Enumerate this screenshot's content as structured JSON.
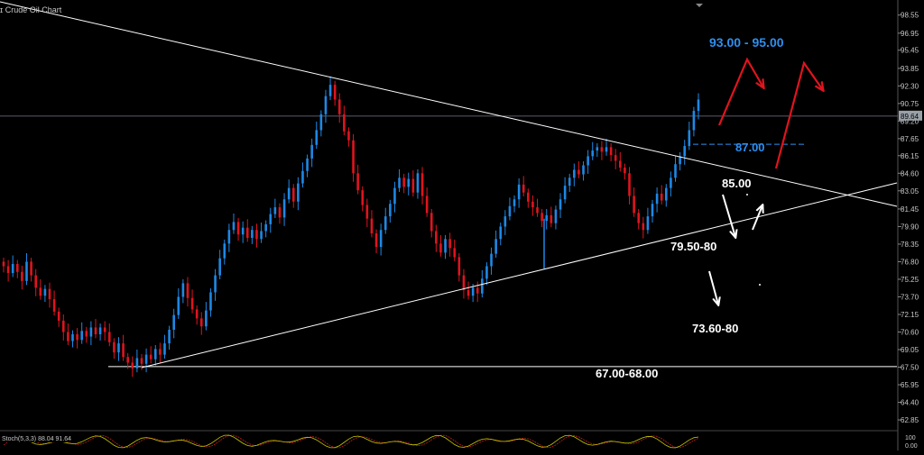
{
  "chart_data": {
    "type": "candlestick",
    "title": "ɪ Crude Oil Chart",
    "y_axis": {
      "ticks": [
        "98.55",
        "96.95",
        "95.45",
        "93.85",
        "92.30",
        "90.75",
        "89.20",
        "87.65",
        "86.15",
        "84.60",
        "83.05",
        "81.45",
        "79.90",
        "78.35",
        "76.80",
        "75.25",
        "73.70",
        "72.15",
        "70.60",
        "69.05",
        "67.50",
        "65.95",
        "64.40",
        "62.85"
      ],
      "range": [
        61.9,
        99.4
      ],
      "current_price_label": "89.64",
      "bottom_labels": [
        "0.00",
        "100"
      ]
    },
    "price_series": {
      "name": "",
      "closes": [
        76.4,
        75.8,
        76.6,
        75.9,
        75.1,
        76.8,
        75.6,
        74.5,
        73.8,
        74.4,
        73.5,
        72.4,
        71.6,
        70.6,
        69.8,
        70.4,
        69.9,
        70.7,
        70.2,
        71.0,
        70.4,
        71.0,
        70.6,
        69.7,
        68.8,
        69.6,
        68.4,
        67.9,
        67.4,
        68.3,
        67.8,
        68.6,
        68.2,
        69.1,
        68.6,
        69.6,
        70.8,
        72.1,
        73.7,
        74.9,
        73.6,
        72.6,
        71.8,
        71.1,
        72.5,
        74.1,
        75.6,
        77.1,
        78.4,
        79.6,
        80.3,
        79.2,
        79.8,
        78.9,
        79.6,
        78.8,
        79.5,
        80.1,
        81.0,
        81.6,
        80.7,
        82.3,
        83.3,
        82.1,
        83.7,
        84.8,
        85.9,
        87.1,
        88.4,
        89.8,
        91.4,
        92.4,
        91.1,
        89.8,
        88.3,
        87.5,
        84.6,
        83.1,
        81.8,
        80.6,
        79.3,
        78.1,
        79.6,
        80.8,
        81.9,
        83.3,
        84.2,
        83.4,
        84.1,
        82.9,
        84.6,
        82.6,
        81.1,
        79.5,
        78.4,
        77.6,
        78.8,
        78.0,
        77.2,
        75.6,
        74.3,
        73.8,
        74.5,
        74.0,
        75.3,
        76.4,
        77.5,
        78.8,
        79.9,
        80.8,
        81.7,
        82.3,
        83.6,
        82.9,
        82.1,
        81.6,
        81.1,
        80.4,
        80.9,
        80.2,
        81.4,
        82.3,
        83.5,
        84.2,
        84.9,
        84.5,
        85.3,
        86.1,
        86.6,
        86.9,
        86.5,
        86.9,
        86.2,
        85.7,
        85.1,
        84.6,
        82.6,
        81.1,
        80.2,
        79.6,
        80.8,
        81.9,
        82.8,
        82.2,
        83.3,
        84.2,
        85.4,
        86.1,
        87.0,
        88.4,
        90.1,
        91.1
      ]
    },
    "trendlines": [
      {
        "from": [
          "start",
          100.2
        ],
        "to": [
          "right-edge",
          81.4
        ],
        "label": ""
      },
      {
        "from": [
          "low",
          67.4
        ],
        "to": [
          "right-edge",
          83.5
        ],
        "label": ""
      }
    ],
    "horizontal_levels": [
      {
        "price": 67.55,
        "label": "67.00-68.00"
      },
      {
        "price": 87.15,
        "label": "87.00"
      }
    ],
    "annotations": [
      {
        "text": "93.00 - 95.00",
        "color": "#2e8ff0"
      },
      {
        "text": "87.00",
        "color": "#2e8ff0"
      },
      {
        "text": "85.00",
        "color": "#ffffff"
      },
      {
        "text": "79.50-80",
        "color": "#ffffff"
      },
      {
        "text": "73.60-80",
        "color": "#ffffff"
      },
      {
        "text": "67.00-68.00",
        "color": "#ffffff"
      }
    ],
    "indicator": {
      "name": "Stoch(5,3,3)",
      "label": "Stoch(5,3,3) 88.04 91.64",
      "values": [
        88.04,
        91.64
      ]
    },
    "colors": {
      "background": "#000000",
      "bull_candle": "#1e88e5",
      "bear_candle": "#e0141e",
      "trendline": "#ffffff",
      "target_up": "#e0141e",
      "target_text": "#2e8ff0",
      "axis_text": "#c8c8c8"
    }
  }
}
